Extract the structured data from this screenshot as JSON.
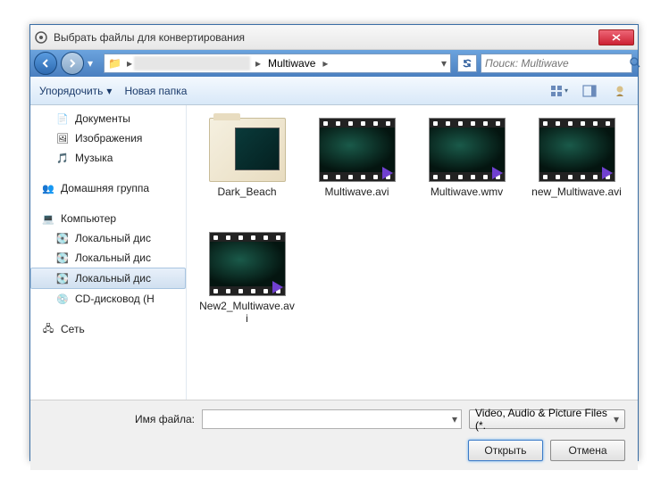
{
  "title": "Выбрать файлы для конвертирования",
  "nav": {
    "current_folder": "Multiwave",
    "search_placeholder": "Поиск: Multiwave"
  },
  "toolbar": {
    "organize": "Упорядочить",
    "new_folder": "Новая папка"
  },
  "sidebar": {
    "documents": "Документы",
    "pictures": "Изображения",
    "music": "Музыка",
    "homegroup": "Домашняя группа",
    "computer": "Компьютер",
    "local_disk_1": "Локальный дис",
    "local_disk_2": "Локальный дис",
    "local_disk_3": "Локальный дис",
    "cd_drive": "CD-дисковод (H",
    "network": "Сеть"
  },
  "files": [
    {
      "name": "Dark_Beach",
      "type": "folder"
    },
    {
      "name": "Multiwave.avi",
      "type": "video"
    },
    {
      "name": "Multiwave.wmv",
      "type": "video"
    },
    {
      "name": "new_Multiwave.avi",
      "type": "video"
    },
    {
      "name": "New2_Multiwave.avi",
      "type": "video"
    }
  ],
  "footer": {
    "filename_label": "Имя файла:",
    "filename_value": "",
    "filter": "Video, Audio & Picture Files (*.",
    "open": "Открыть",
    "cancel": "Отмена"
  }
}
